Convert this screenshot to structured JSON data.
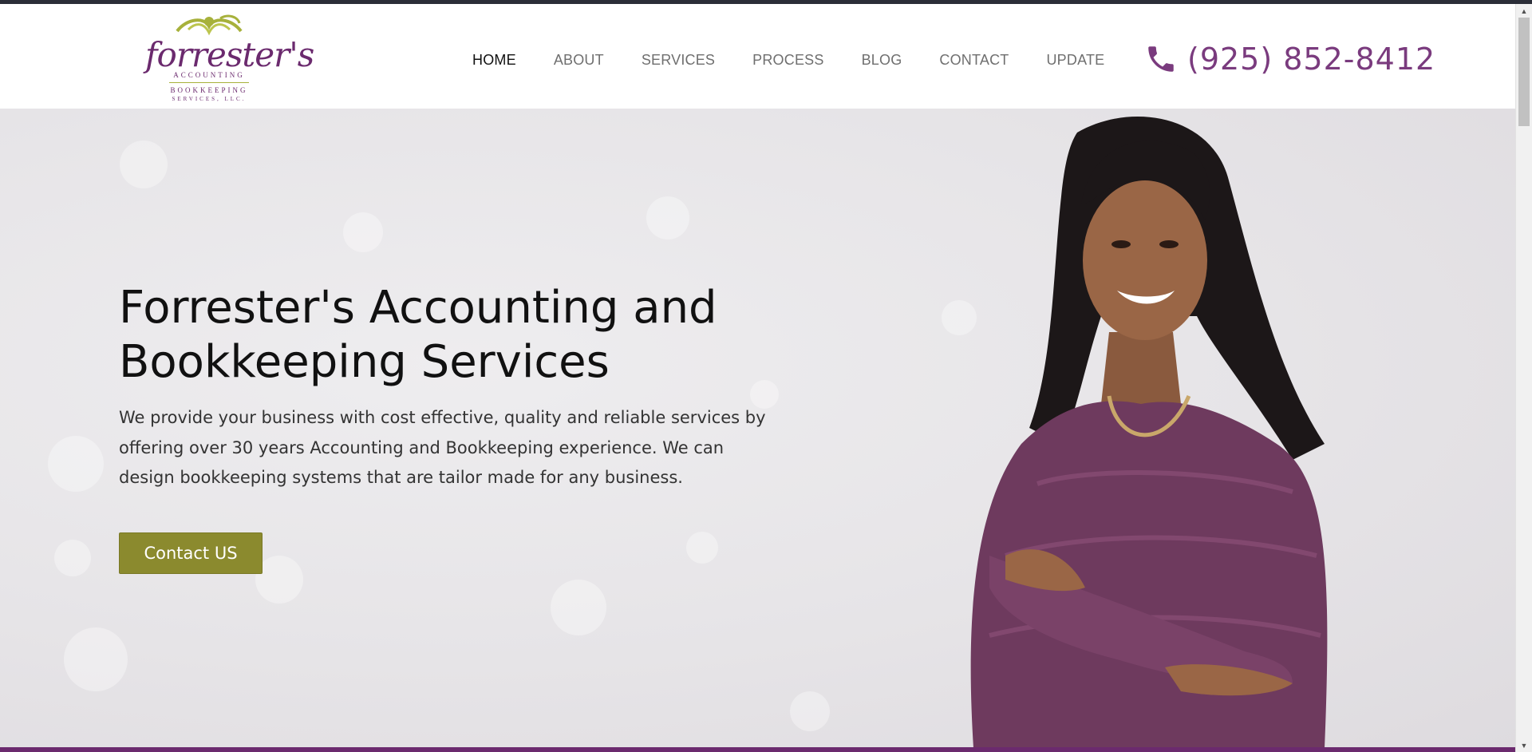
{
  "logo": {
    "brand": "forrester's",
    "line1": "ACCOUNTING",
    "line2": "BOOKKEEPING",
    "line3": "SERVICES, LLC."
  },
  "nav": {
    "items": [
      {
        "label": "HOME",
        "active": true
      },
      {
        "label": "ABOUT",
        "active": false
      },
      {
        "label": "SERVICES",
        "active": false
      },
      {
        "label": "PROCESS",
        "active": false
      },
      {
        "label": "BLOG",
        "active": false
      },
      {
        "label": "CONTACT",
        "active": false
      },
      {
        "label": "UPDATE",
        "active": false
      }
    ]
  },
  "phone": {
    "icon": "phone-icon",
    "number": "(925) 852-8412"
  },
  "hero": {
    "title_line1": "Forrester's Accounting and",
    "title_line2": "Bookkeeping Services",
    "description_line1": "We provide your business with cost effective, quality and reliable services by",
    "description_line2": "offering over 30 years Accounting and Bookkeeping experience. We can",
    "description_line3": "design bookkeeping systems that are tailor made for any business.",
    "cta_label": "Contact US"
  },
  "colors": {
    "brand_purple": "#6b2a6e",
    "phone_purple": "#7a3b7e",
    "cta_olive": "#8b8a2e",
    "logo_green": "#a7b13b"
  }
}
